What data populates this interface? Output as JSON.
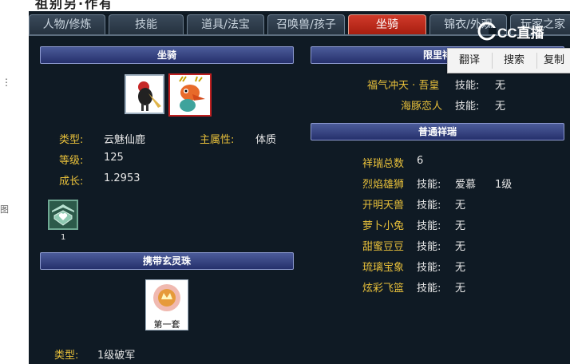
{
  "top_strip": {
    "title": "祖别另·作有"
  },
  "margin": {
    "glyph": "图"
  },
  "tabs": [
    {
      "label": "人物/修炼",
      "active": false
    },
    {
      "label": "技能",
      "active": false
    },
    {
      "label": "道具/法宝",
      "active": false
    },
    {
      "label": "召唤兽/孩子",
      "active": false
    },
    {
      "label": "坐骑",
      "active": true
    },
    {
      "label": "锦衣/外观",
      "active": false
    },
    {
      "label": "玩家之家",
      "active": false
    }
  ],
  "left": {
    "mount_header": "坐骑",
    "type_label": "类型:",
    "type_value": "云魅仙鹿",
    "main_attr_label": "主属性:",
    "main_attr_value": "体质",
    "level_label": "等级:",
    "level_value": "125",
    "growth_label": "成长:",
    "growth_value": "1.2953",
    "skill_count": "1",
    "pearl_header": "携带玄灵珠",
    "pearl_set": "第一套",
    "pearl_type_label": "类型:",
    "pearl_type_value": "1级破军"
  },
  "right": {
    "limited_header": "限里祥",
    "limited_items": [
      {
        "name": "福气冲天 · 吾皇",
        "skill_label": "技能:",
        "skill_value": "无"
      },
      {
        "name": "海豚恋人",
        "skill_label": "技能:",
        "skill_value": "无"
      }
    ],
    "normal_header": "普通祥瑞",
    "total_label": "祥瑞总数",
    "total_value": "6",
    "normal_items": [
      {
        "name": "烈焰雄狮",
        "skill_label": "技能:",
        "skill_value": "爱慕",
        "level": "1级"
      },
      {
        "name": "开明天兽",
        "skill_label": "技能:",
        "skill_value": "无",
        "level": ""
      },
      {
        "name": "萝卜小兔",
        "skill_label": "技能:",
        "skill_value": "无",
        "level": ""
      },
      {
        "name": "甜蜜豆豆",
        "skill_label": "技能:",
        "skill_value": "无",
        "level": ""
      },
      {
        "name": "琉璃宝象",
        "skill_label": "技能:",
        "skill_value": "无",
        "level": ""
      },
      {
        "name": "炫彩飞篮",
        "skill_label": "技能:",
        "skill_value": "无",
        "level": ""
      }
    ]
  },
  "context_menu": {
    "translate": "翻译",
    "search": "搜索",
    "copy": "复制"
  },
  "watermark": {
    "text": "CC直播"
  },
  "colors": {
    "bg": "#0f1a24",
    "accent_red": "#c02020",
    "label_yellow": "#e8c03a",
    "header_blue": "#2f3b7a"
  }
}
